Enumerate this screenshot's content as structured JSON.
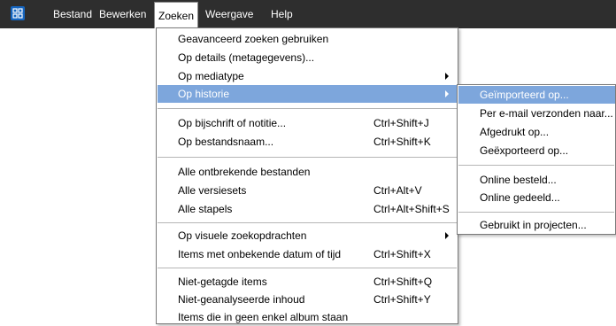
{
  "menubar": {
    "items": [
      "Bestand",
      "Bewerken",
      "Zoeken",
      "Weergave",
      "Help"
    ],
    "active": "Zoeken"
  },
  "dropdown": {
    "items": [
      {
        "label": "Geavanceerd zoeken gebruiken",
        "shortcut": ""
      },
      {
        "label": "Op details (metagegevens)...",
        "shortcut": ""
      },
      {
        "label": "Op mediatype",
        "shortcut": ""
      },
      {
        "label": "Op historie",
        "shortcut": ""
      },
      {
        "label": "Op bijschrift of notitie...",
        "shortcut": "Ctrl+Shift+J"
      },
      {
        "label": "Op bestandsnaam...",
        "shortcut": "Ctrl+Shift+K"
      },
      {
        "label": "Alle ontbrekende bestanden",
        "shortcut": ""
      },
      {
        "label": "Alle versiesets",
        "shortcut": "Ctrl+Alt+V"
      },
      {
        "label": "Alle stapels",
        "shortcut": "Ctrl+Alt+Shift+S"
      },
      {
        "label": "Op visuele zoekopdrachten",
        "shortcut": ""
      },
      {
        "label": "Items met onbekende datum of tijd",
        "shortcut": "Ctrl+Shift+X"
      },
      {
        "label": "Niet-getagde items",
        "shortcut": "Ctrl+Shift+Q"
      },
      {
        "label": "Niet-geanalyseerde inhoud",
        "shortcut": "Ctrl+Shift+Y"
      },
      {
        "label": "Items die in geen enkel album staan",
        "shortcut": ""
      }
    ],
    "highlighted": "Op historie"
  },
  "submenu": {
    "items": [
      "Geïmporteerd op...",
      "Per e-mail verzonden naar...",
      "Afgedrukt op...",
      "Geëxporteerd op...",
      "Online besteld...",
      "Online gedeeld...",
      "Gebruikt in projecten..."
    ],
    "highlighted": "Geïmporteerd op..."
  },
  "colors": {
    "menubar_bg": "#2e2e2e",
    "highlight": "#7da6dc",
    "app_icon": "#1565c0"
  }
}
